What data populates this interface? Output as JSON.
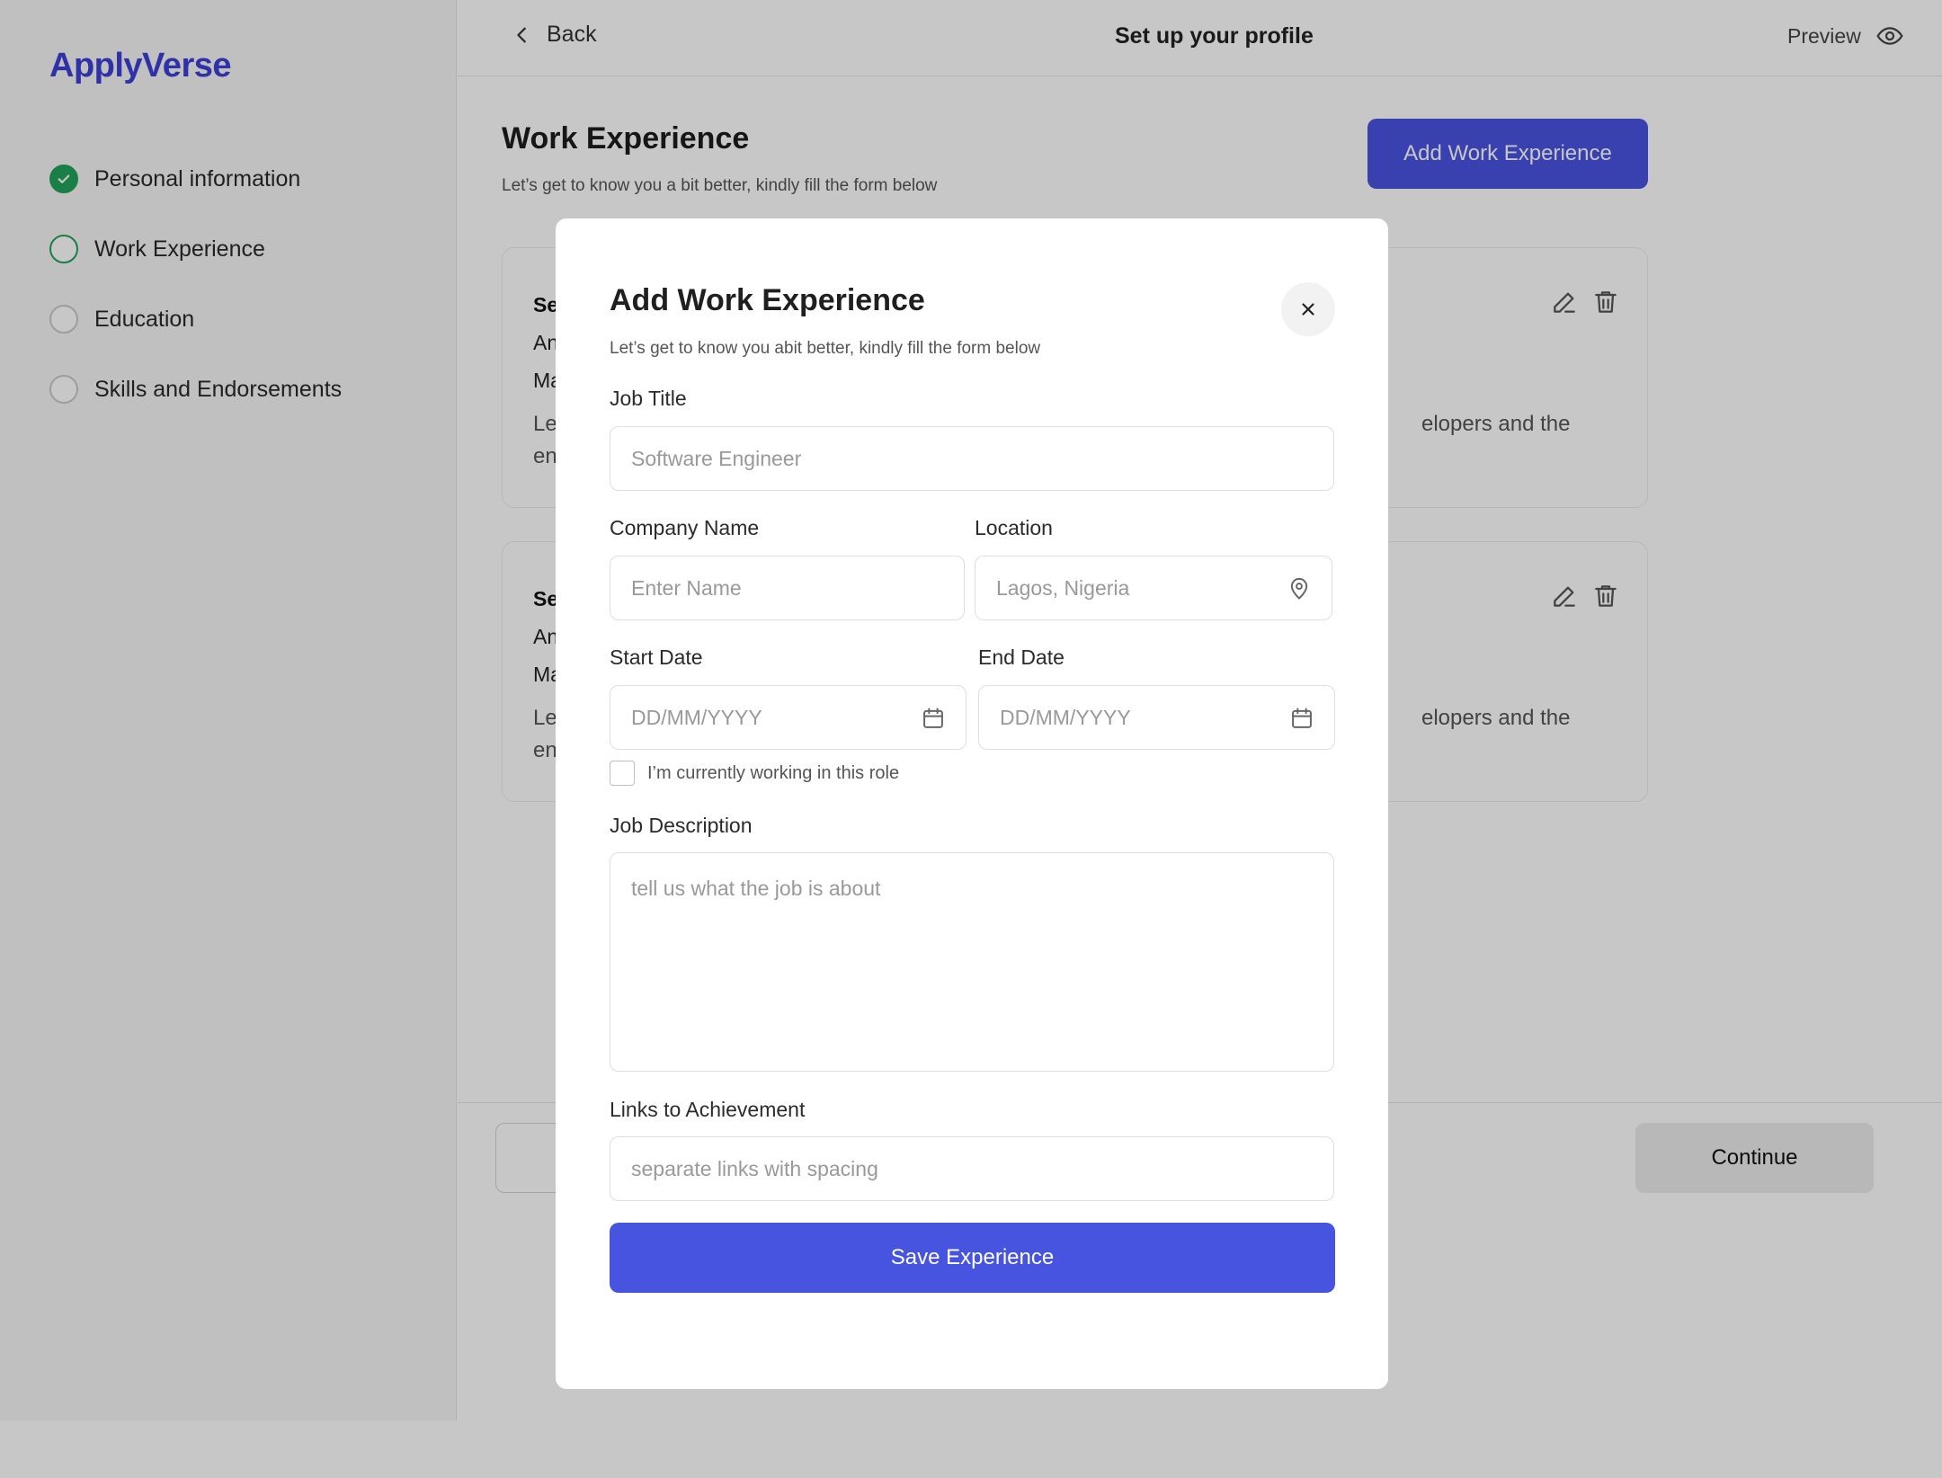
{
  "app": {
    "logo": "ApplyVerse"
  },
  "sidebar": {
    "steps": [
      {
        "label": "Personal information",
        "state": "done"
      },
      {
        "label": "Work Experience",
        "state": "active"
      },
      {
        "label": "Education",
        "state": "pending"
      },
      {
        "label": "Skills and Endorsements",
        "state": "pending"
      }
    ]
  },
  "topbar": {
    "back_label": "Back",
    "title": "Set up your profile",
    "preview_label": "Preview"
  },
  "page": {
    "title": "Work Experience",
    "subtitle": "Let’s get to know you a bit better, kindly fill the form below",
    "add_button": "Add Work Experience"
  },
  "cards": [
    {
      "title": "Se",
      "line1": "An",
      "line2": "Ma",
      "desc1": "Le",
      "desc1_tail": "elopers and the",
      "desc2": "en"
    },
    {
      "title": "Se",
      "line1": "An",
      "line2": "Ma",
      "desc1": "Le",
      "desc1_tail": "elopers and the",
      "desc2": "en"
    }
  ],
  "footer": {
    "continue_label": "Continue"
  },
  "modal": {
    "title": "Add Work Experience",
    "subtitle": "Let’s get to know you abit better, kindly fill the form below",
    "job_title": {
      "label": "Job Title",
      "placeholder": "Software Engineer"
    },
    "company": {
      "label": "Company Name",
      "placeholder": "Enter Name"
    },
    "location": {
      "label": "Location",
      "placeholder": "Lagos, Nigeria"
    },
    "start_date": {
      "label": "Start Date",
      "placeholder": "DD/MM/YYYY"
    },
    "end_date": {
      "label": "End Date",
      "placeholder": "DD/MM/YYYY"
    },
    "current_role": {
      "label": "I’m currently working in this role",
      "checked": false
    },
    "description": {
      "label": "Job Description",
      "placeholder": "tell us what the job is about"
    },
    "links": {
      "label": "Links to Achievement",
      "placeholder": "separate links with spacing"
    },
    "save_button": "Save Experience"
  },
  "colors": {
    "brand": "#3b3fd8",
    "primary_button": "#4654e0",
    "success": "#20a35a"
  }
}
